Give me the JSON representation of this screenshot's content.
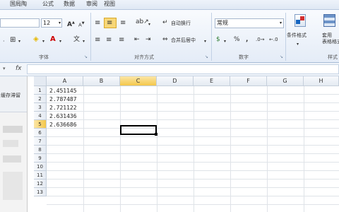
{
  "menu": {
    "tabs": [
      "国局陶",
      "公式",
      "数据",
      "审阅",
      "视图"
    ]
  },
  "ribbon": {
    "font_size": "12",
    "font_size_up": "A",
    "font_size_down": "A",
    "wrap_text_label": "自动换行",
    "merge_center_label": "合并后居中",
    "number_format_value": "常规",
    "percent_symbol": "%",
    "comma_symbol": ",",
    "conditional_format_label": "条件格式",
    "table_format_label": "套用\n表格格式",
    "groups": {
      "font": "字体",
      "alignment": "对齐方式",
      "number": "数字",
      "styles": "样式"
    }
  },
  "formula_bar": {
    "fx": "fx",
    "value": ""
  },
  "left_pane": {
    "label": "缓存滞留"
  },
  "sheet": {
    "columns": [
      "A",
      "B",
      "C",
      "D",
      "E",
      "F",
      "G",
      "H"
    ],
    "rows": [
      "1",
      "2",
      "3",
      "4",
      "5",
      "6",
      "7",
      "8",
      "9",
      "10",
      "11",
      "12",
      "13"
    ],
    "selected_col": "C",
    "selected_row": "5",
    "cells_A": [
      "2.451145",
      "2.787487",
      "2.721122",
      "2.631436",
      "2.636686"
    ]
  },
  "colors": {
    "selection": "#000000",
    "ribbon_accent": "#f4c74a"
  }
}
